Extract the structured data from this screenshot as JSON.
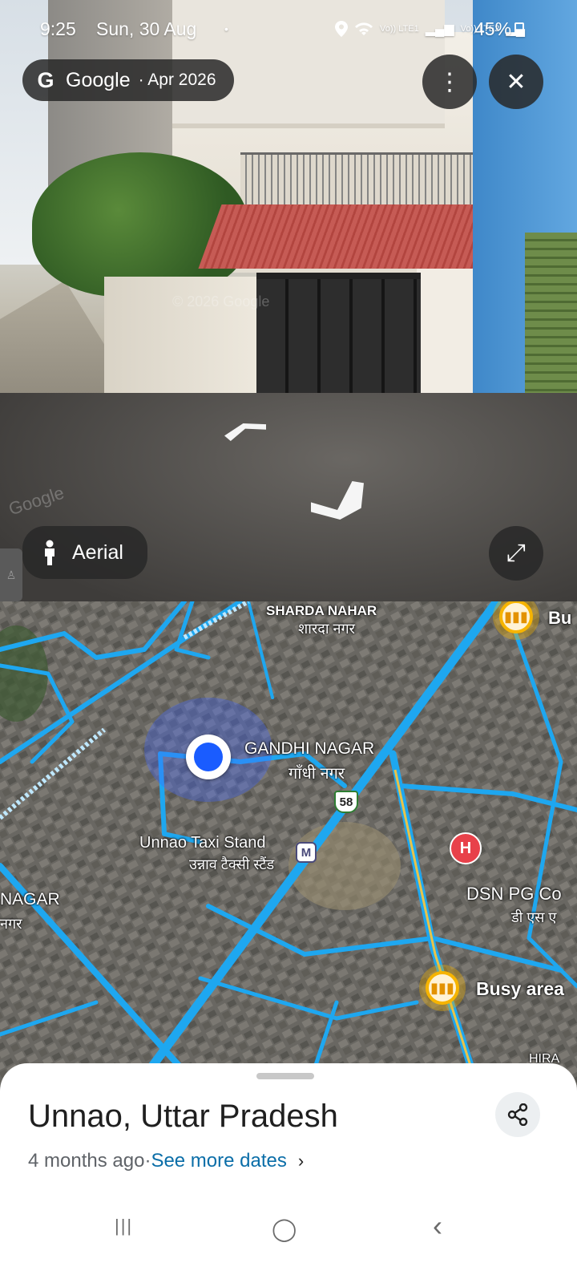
{
  "status_bar": {
    "time": "9:25",
    "date": "Sun, 30 Aug",
    "dot": "•",
    "lte1": "Vo)) LTE1",
    "lte2": "Vo)) LTE2",
    "battery": "45%"
  },
  "street_view": {
    "brand": "Google",
    "brand_icon": "G",
    "capture_date": "· Apr 2026",
    "menu_icon": "⋮",
    "close_icon": "✕",
    "aerial_label": "Aerial",
    "expand_icon": "⤢",
    "watermark_1": "© 2026 Google",
    "watermark_2": "Google"
  },
  "map": {
    "labels": {
      "sharda_en": "SHARDA NAHAR",
      "sharda_hi": "शारदा नगर",
      "gandhi_en": "GANDHI NAGAR",
      "gandhi_hi": "गाँधी नगर",
      "highway": "58",
      "taxi_en": "Unnao Taxi Stand",
      "taxi_hi": "उन्नाव टैक्सी स्टैंड",
      "nagar_en": "NAGAR",
      "nagar_hi": "नगर",
      "dsn_en": "DSN PG Co",
      "dsn_hi": "डी एस ए",
      "busy": "Busy area",
      "bu": "Bu",
      "hira": "HIRA"
    },
    "metro_letter": "M",
    "hospital_letter": "H"
  },
  "sheet": {
    "title": "Unnao, Uttar Pradesh",
    "age": "4 months ago",
    "separator": " · ",
    "see_more": "See more dates",
    "chevron": "›"
  },
  "navbar": {
    "recents": "|||",
    "home": "◯",
    "back": "‹"
  },
  "colors": {
    "road_highlight": "#1ea7f0",
    "accent_link": "#0b6ea8",
    "location_blue": "#1a5cff",
    "busy_yellow": "#f6b400",
    "hospital_red": "#e8414a"
  }
}
